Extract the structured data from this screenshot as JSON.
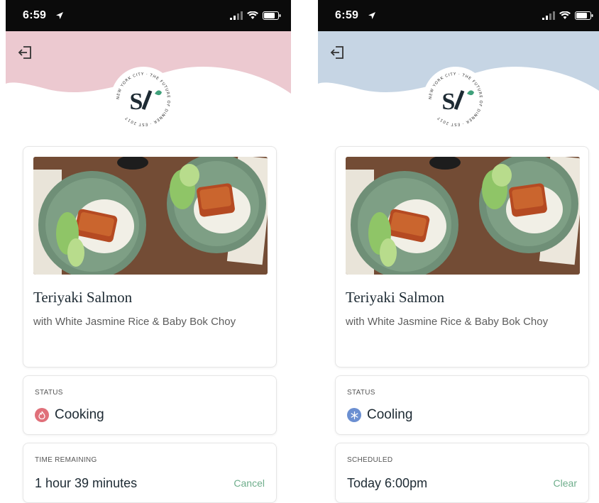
{
  "colors": {
    "pink_header": "#ecc9d0",
    "blue_header": "#c6d5e4",
    "accent_green": "#6fae8c",
    "cooking_icon": "#e0707a",
    "cooling_icon": "#6b8fd1"
  },
  "screens": [
    {
      "status_bar": {
        "time": "6:59"
      },
      "logo": {
        "letters": "S",
        "ring_text": "NEW YORK CITY · THE FUTURE OF DINNER · EST 2017"
      },
      "meal": {
        "title": "Teriyaki Salmon",
        "subtitle": "with White Jasmine Rice & Baby Bok Choy"
      },
      "status": {
        "caption": "STATUS",
        "value": "Cooking",
        "icon": "flame-icon"
      },
      "timing": {
        "caption": "TIME REMAINING",
        "value": "1 hour 39 minutes",
        "action": "Cancel"
      }
    },
    {
      "status_bar": {
        "time": "6:59"
      },
      "logo": {
        "letters": "S",
        "ring_text": "NEW YORK CITY · THE FUTURE OF DINNER · EST 2017"
      },
      "meal": {
        "title": "Teriyaki Salmon",
        "subtitle": "with White Jasmine Rice & Baby Bok Choy"
      },
      "status": {
        "caption": "STATUS",
        "value": "Cooling",
        "icon": "snowflake-icon"
      },
      "timing": {
        "caption": "SCHEDULED",
        "value": "Today 6:00pm",
        "action": "Clear"
      }
    }
  ]
}
